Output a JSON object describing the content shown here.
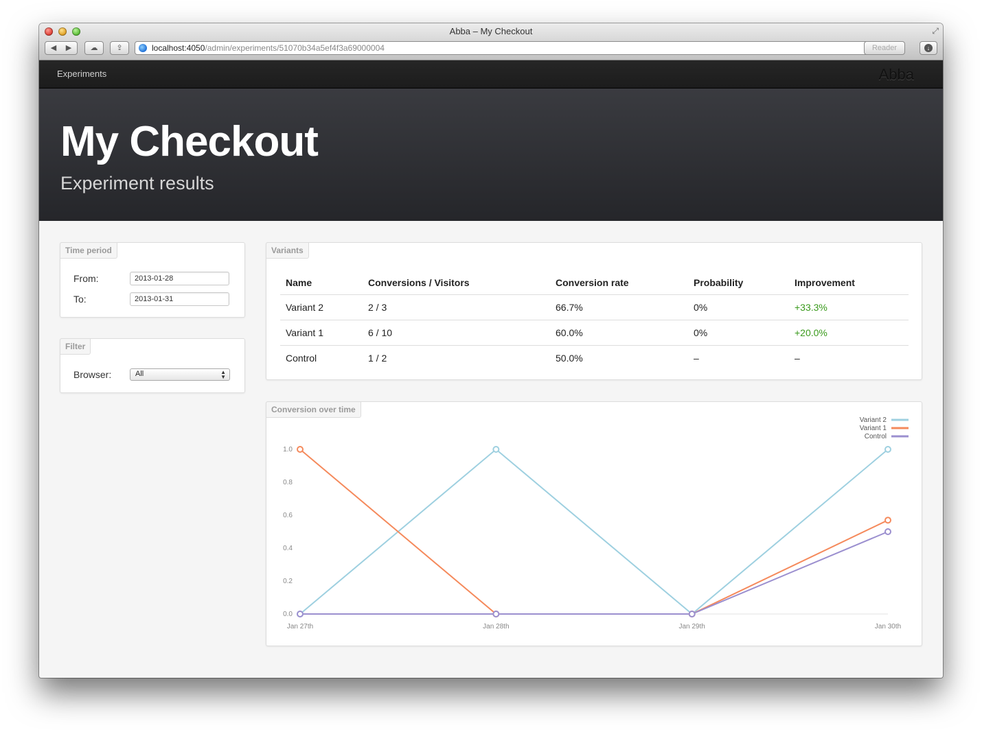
{
  "window": {
    "title": "Abba – My Checkout",
    "url_host": "localhost:4050",
    "url_path": "/admin/experiments/51070b34a5ef4f3a69000004",
    "reader_label": "Reader"
  },
  "navbar": {
    "link": "Experiments",
    "brand": "Abba"
  },
  "hero": {
    "title": "My Checkout",
    "subtitle": "Experiment results"
  },
  "time_period": {
    "tag": "Time period",
    "from_label": "From:",
    "from_value": "2013-01-28",
    "to_label": "To:",
    "to_value": "2013-01-31"
  },
  "filter": {
    "tag": "Filter",
    "browser_label": "Browser:",
    "browser_value": "All"
  },
  "variants": {
    "tag": "Variants",
    "headers": [
      "Name",
      "Conversions / Visitors",
      "Conversion rate",
      "Probability",
      "Improvement"
    ],
    "rows": [
      {
        "name": "Variant 2",
        "conversions": "2 / 3",
        "rate": "66.7%",
        "probability": "0%",
        "improvement": "+33.3%"
      },
      {
        "name": "Variant 1",
        "conversions": "6 / 10",
        "rate": "60.0%",
        "probability": "0%",
        "improvement": "+20.0%"
      },
      {
        "name": "Control",
        "conversions": "1 / 2",
        "rate": "50.0%",
        "probability": "–",
        "improvement": "–"
      }
    ],
    "improvement_color": "#3a9a1c"
  },
  "conversion_chart": {
    "tag": "Conversion over time"
  },
  "chart_data": {
    "type": "line",
    "title": "",
    "xlabel": "",
    "ylabel": "",
    "x": [
      "Jan 27th",
      "Jan 28th",
      "Jan 29th",
      "Jan 30th"
    ],
    "ylim": [
      0,
      1
    ],
    "yticks": [
      "0.0",
      "0.2",
      "0.4",
      "0.6",
      "0.8",
      "1.0"
    ],
    "legend_position": "top-right",
    "grid": false,
    "series": [
      {
        "name": "Variant 2",
        "color": "#9ed0e0",
        "values": [
          0.0,
          1.0,
          0.0,
          1.0
        ]
      },
      {
        "name": "Variant 1",
        "color": "#f58a5c",
        "values": [
          1.0,
          0.0,
          0.0,
          0.57
        ]
      },
      {
        "name": "Control",
        "color": "#9b8fcf",
        "values": [
          0.0,
          0.0,
          0.0,
          0.5
        ]
      }
    ]
  }
}
